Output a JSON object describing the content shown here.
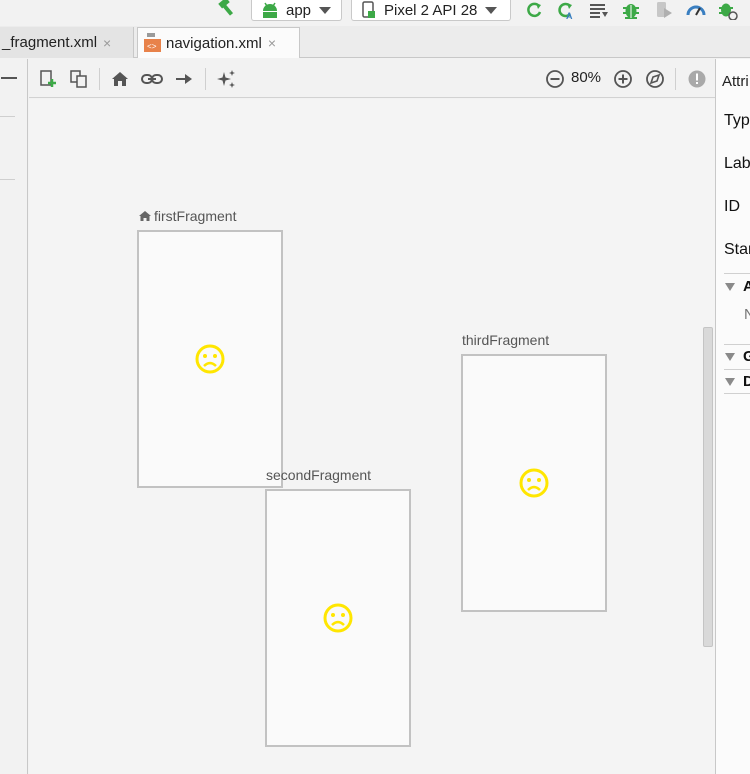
{
  "run_toolbar": {
    "run_config": "app",
    "device": "Pixel 2 API 28"
  },
  "tabs": [
    {
      "label": "_fragment.xml",
      "close": "×",
      "active": false
    },
    {
      "label": "navigation.xml",
      "close": "×",
      "active": true
    }
  ],
  "design_toolbar": {
    "zoom": "80%"
  },
  "canvas": {
    "fragments": [
      {
        "name": "firstFragment",
        "start_destination": true,
        "icon": "sad-face-icon"
      },
      {
        "name": "secondFragment",
        "start_destination": false,
        "icon": "sad-face-icon"
      },
      {
        "name": "thirdFragment",
        "start_destination": false,
        "icon": "sad-face-icon"
      }
    ]
  },
  "attributes_panel": {
    "title": "Attri",
    "rows": [
      "Typ",
      "Lab",
      "ID",
      "Star"
    ],
    "sections": [
      "A",
      "G",
      "D"
    ],
    "sub_item": "N"
  },
  "colors": {
    "placeholder_face": "#ffe600",
    "android_green": "#3da947",
    "run_blue": "#3a7fc1"
  }
}
